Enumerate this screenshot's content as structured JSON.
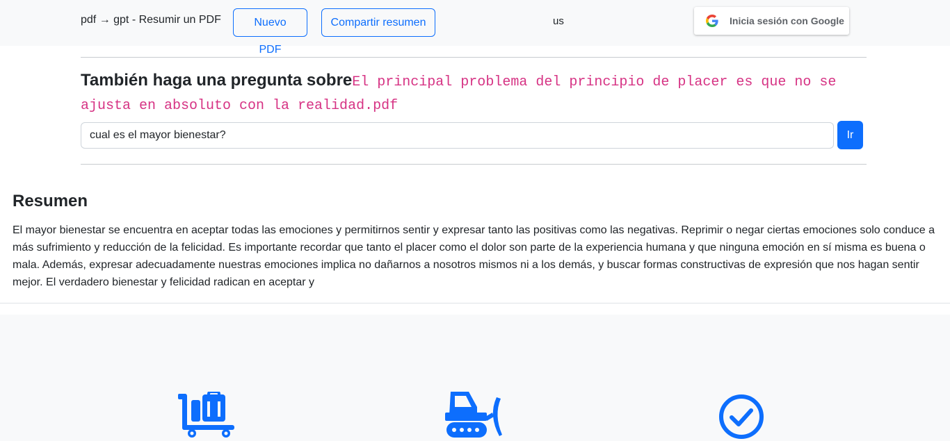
{
  "header": {
    "brand": "pdf → gpt - Resumir un PDF",
    "new_pdf_label": "Nuevo PDF",
    "share_label": "Compartir resumen",
    "language": "us",
    "google_signin_label": "Inicia sesión con Google"
  },
  "question": {
    "title_prefix": "También haga una pregunta sobre",
    "filename": "El principal problema del principio de placer es que no se ajusta en absoluto con la realidad.pdf",
    "input_value": "cual es el mayor bienestar?",
    "submit_label": "Ir"
  },
  "summary": {
    "heading": "Resumen",
    "text": "El mayor bienestar se encuentra en aceptar todas las emociones y permitirnos sentir y expresar tanto las positivas como las negativas. Reprimir o negar ciertas emociones solo conduce a más sufrimiento y reducción de la felicidad. Es importante recordar que tanto el placer como el dolor son parte de la experiencia humana y que ninguna emoción en sí misma es buena o mala. Además, expresar adecuadamente nuestras emociones implica no dañarnos a nosotros mismos ni a los demás, y buscar formas constructivas de expresión que nos hagan sentir mejor. El verdadero bienestar y felicidad radican en aceptar y"
  },
  "features": {
    "icons": [
      "luggage-cart-icon",
      "bulldozer-icon",
      "check-circle-icon"
    ]
  },
  "colors": {
    "primary": "#0d6efd",
    "code": "#d63384",
    "light_bg": "#f8f9fa"
  }
}
